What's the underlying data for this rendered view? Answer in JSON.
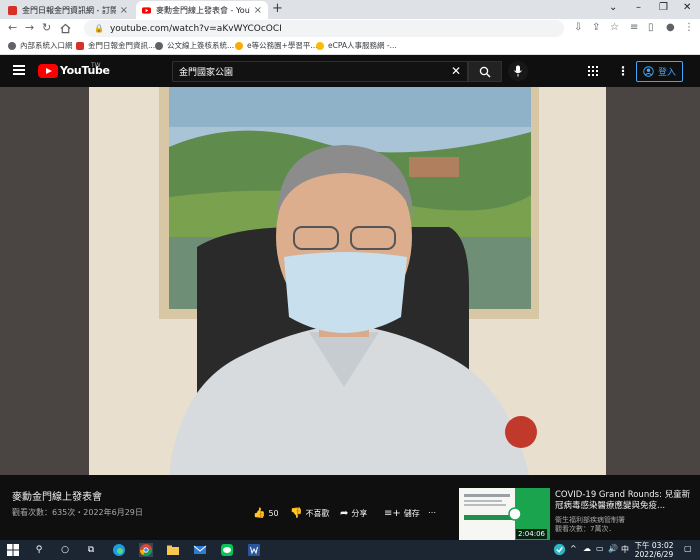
{
  "browser": {
    "tabs": [
      {
        "title": "金門日報金門資訊網 - 訂閱電子報",
        "active": false
      },
      {
        "title": "麥勳金門線上發表會 - YouTube",
        "active": true
      }
    ],
    "new_tab": "+",
    "url": "youtube.com/watch?v=aKvWYCOcOCI",
    "bookmarks": [
      "內部系統入口網",
      "金門日報金門資訊...",
      "公文線上簽核系統...",
      "e等公務園+學習平...",
      "eCPA人事服務網 -..."
    ]
  },
  "youtube": {
    "logo_text": "YouTube",
    "country": "TW",
    "search_query": "金門國家公園",
    "sign_in": "登入"
  },
  "video": {
    "title": "麥勳金門線上發表會",
    "meta": "觀看次數：635次・2022年6月29日",
    "likes": "50",
    "dislike_label": "不喜歡",
    "share_label": "分享",
    "save_label": "儲存",
    "more_label": "⋯"
  },
  "recommended": {
    "title": "COVID-19 Grand Rounds: 兒童新冠病毒感染醫療應變與免疫...",
    "channel": "衛生福利部疾病管制署",
    "views": "觀看次數：7萬次．",
    "duration": "2:04:06"
  },
  "taskbar": {
    "ime": "中",
    "time": "下午 03:02",
    "date": "2022/6/29"
  },
  "colors": {
    "youtube_red": "#ff0000",
    "signin_blue": "#3ea6ff",
    "page_dark": "#0f0f0f"
  }
}
